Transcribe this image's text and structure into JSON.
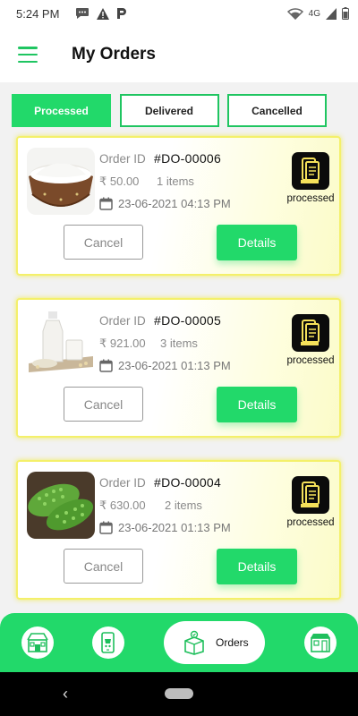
{
  "status_bar": {
    "time": "5:24 PM",
    "network": "4G"
  },
  "header": {
    "title": "My Orders"
  },
  "tabs": [
    {
      "label": "Processed",
      "active": true
    },
    {
      "label": "Delivered",
      "active": false
    },
    {
      "label": "Cancelled",
      "active": false
    }
  ],
  "orders": [
    {
      "id_label": "Order ID",
      "id": "#DO-00006",
      "price": "₹ 50.00",
      "items": "1 items",
      "date": "23-06-2021 04:13 PM",
      "status": "processed",
      "cancel": "Cancel",
      "details": "Details",
      "image": "flour-bowl"
    },
    {
      "id_label": "Order ID",
      "id": "#DO-00005",
      "price": "₹ 921.00",
      "items": "3 items",
      "date": "23-06-2021 01:13 PM",
      "status": "processed",
      "cancel": "Cancel",
      "details": "Details",
      "image": "milk-bottles"
    },
    {
      "id_label": "Order ID",
      "id": "#DO-00004",
      "price": "₹ 630.00",
      "items": "2 items",
      "date": "23-06-2021 01:13 PM",
      "status": "processed",
      "cancel": "Cancel",
      "details": "Details",
      "image": "bitter-gourd"
    }
  ],
  "bottom_nav": {
    "active_label": "Orders"
  },
  "colors": {
    "accent": "#22d96a",
    "card_border": "#f4f06a"
  }
}
